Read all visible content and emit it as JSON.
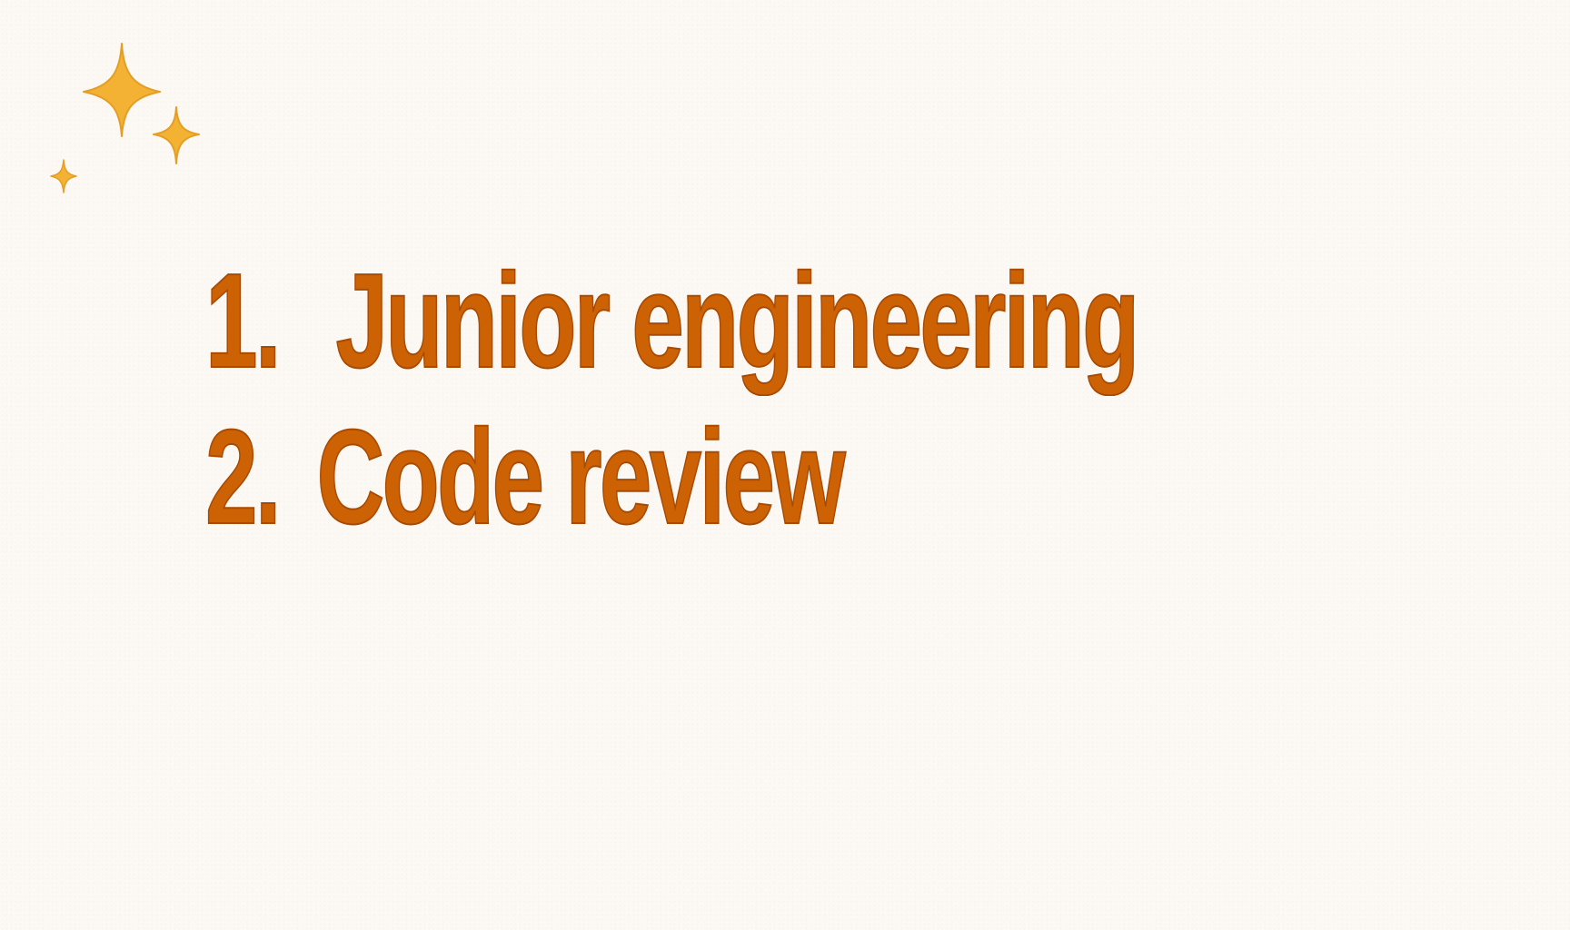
{
  "decoration": {
    "sparkle_color": "#f3b233",
    "sparkles": [
      {
        "icon": "large-sparkle-icon"
      },
      {
        "icon": "medium-sparkle-icon"
      },
      {
        "icon": "small-sparkle-icon"
      }
    ]
  },
  "text_color": "#cc6203",
  "background_color": "#fcf9f4",
  "list": {
    "items": [
      {
        "number": "1.",
        "label": "Junior engineering"
      },
      {
        "number": "2.",
        "label": "Code review"
      }
    ]
  }
}
